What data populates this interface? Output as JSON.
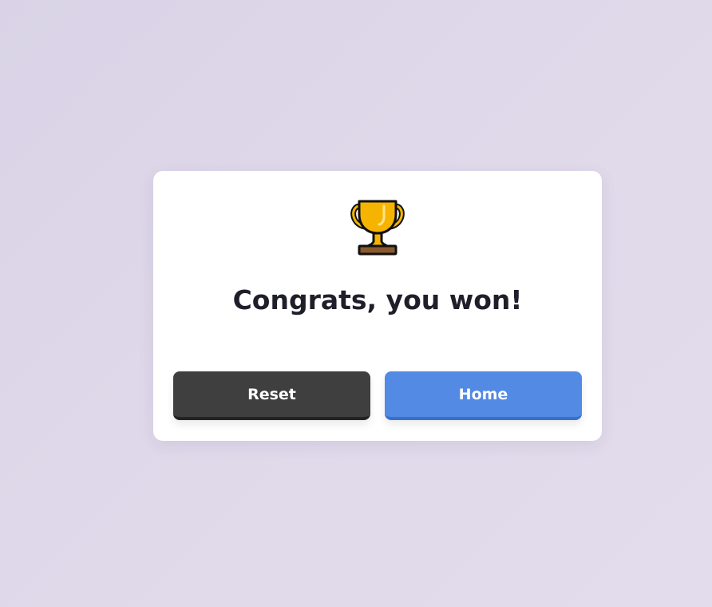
{
  "dialog": {
    "icon": "trophy-icon",
    "title": "Congrats, you won!",
    "buttons": {
      "reset_label": "Reset",
      "home_label": "Home"
    }
  },
  "colors": {
    "background": "#dfd9ea",
    "dialog_bg": "#ffffff",
    "reset_button": "#3f3f3f",
    "home_button": "#528ae4",
    "title_text": "#1f1f2b"
  }
}
